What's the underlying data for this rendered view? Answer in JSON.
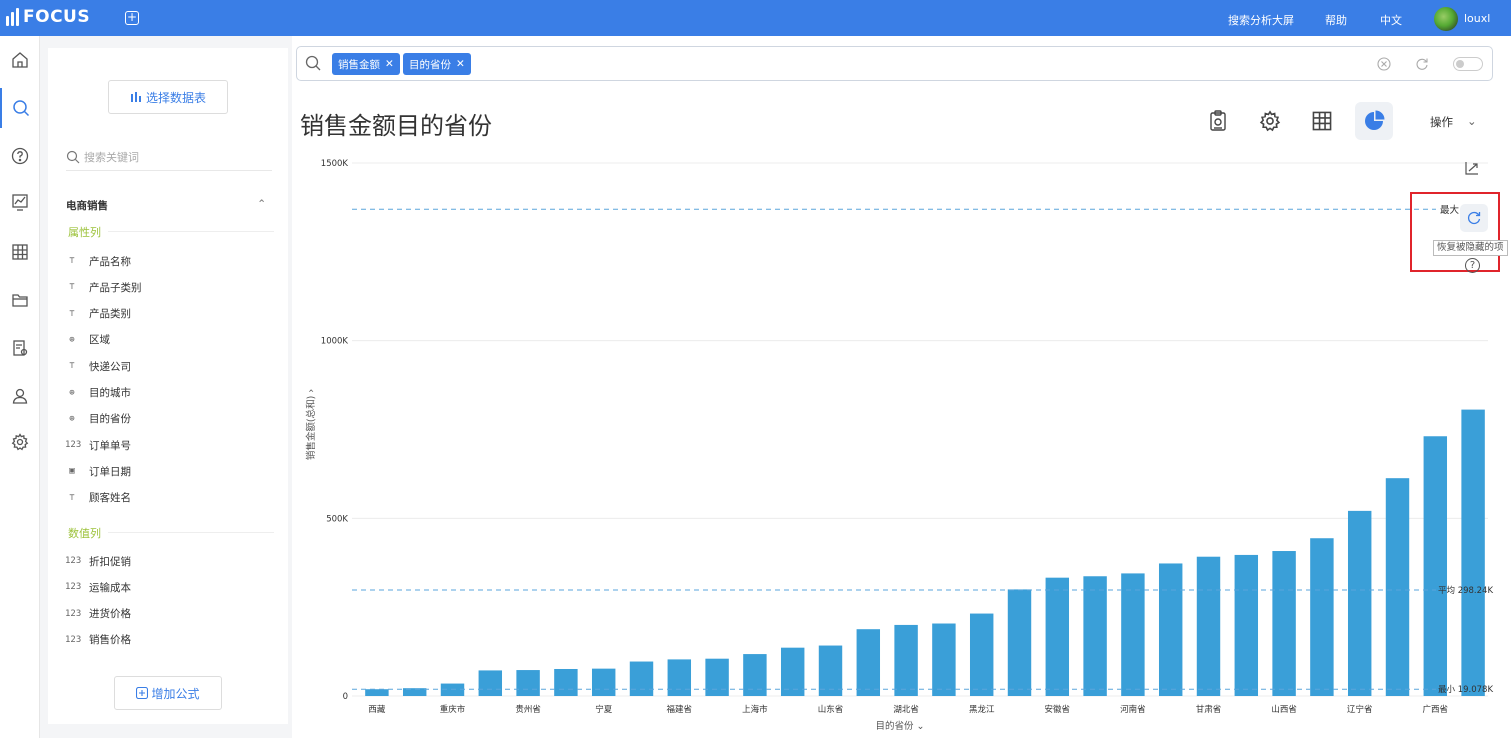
{
  "app": {
    "logo_text": "FOCUS",
    "nav_links": [
      "搜索分析大屏",
      "帮助",
      "中文"
    ],
    "username": "louxl"
  },
  "rail": {
    "items": [
      "home-icon",
      "search-icon",
      "help-icon",
      "dashboard-icon",
      "table-icon",
      "folder-icon",
      "report-settings-icon",
      "user-icon",
      "settings-icon"
    ],
    "active": "search-icon"
  },
  "panel": {
    "select_table_label": "选择数据表",
    "search_placeholder": "搜索关键词",
    "group_name": "电商销售",
    "attribute_section": "属性列",
    "attribute_columns": [
      {
        "icon": "text-type-icon",
        "label": "产品名称"
      },
      {
        "icon": "text-type-icon",
        "label": "产品子类别"
      },
      {
        "icon": "text-type-icon",
        "label": "产品类别"
      },
      {
        "icon": "globe-icon",
        "label": "区域"
      },
      {
        "icon": "text-type-icon",
        "label": "快递公司"
      },
      {
        "icon": "globe-icon",
        "label": "目的城市"
      },
      {
        "icon": "globe-icon",
        "label": "目的省份"
      },
      {
        "icon": "number-type-icon",
        "label": "订单单号"
      },
      {
        "icon": "calendar-icon",
        "label": "订单日期"
      },
      {
        "icon": "text-type-icon",
        "label": "顾客姓名"
      }
    ],
    "number_section": "数值列",
    "number_columns": [
      {
        "icon": "number-type-icon",
        "label": "折扣促销"
      },
      {
        "icon": "number-type-icon",
        "label": "运输成本"
      },
      {
        "icon": "number-type-icon",
        "label": "进货价格"
      },
      {
        "icon": "number-type-icon",
        "label": "销售价格"
      }
    ],
    "add_formula_label": "增加公式"
  },
  "search": {
    "tokens": [
      "销售金额",
      "目的省份"
    ]
  },
  "main": {
    "title": "销售金额目的省份",
    "ops_label": "操作"
  },
  "tooltip": {
    "max_label": "最大",
    "restore_text": "恢复被隐藏的项",
    "help_glyph": "?"
  },
  "colors": {
    "brand": "#3a7ee6",
    "bar": "#3a9fd8",
    "highlight": "#e0242b"
  },
  "chart_data": {
    "type": "bar",
    "xlabel": "目的省份",
    "ylabel": "销售金额(总和)",
    "ylim": [
      0,
      1500000
    ],
    "y_ticks": [
      {
        "value": 0,
        "label": "0"
      },
      {
        "value": 500000,
        "label": "500K"
      },
      {
        "value": 1000000,
        "label": "1000K"
      },
      {
        "value": 1500000,
        "label": "1500K"
      }
    ],
    "categories": [
      "西藏",
      "",
      "重庆市",
      "",
      "贵州省",
      "",
      "宁夏",
      "",
      "福建省",
      "",
      "上海市",
      "",
      "山东省",
      "",
      "湖北省",
      "",
      "黑龙江",
      "",
      "安徽省",
      "",
      "河南省",
      "",
      "甘肃省",
      "",
      "山西省",
      "",
      "辽宁省",
      "",
      "广西省"
    ],
    "values": [
      19078,
      22000,
      35000,
      72000,
      73000,
      76000,
      77000,
      97000,
      103000,
      105000,
      118000,
      136000,
      142000,
      188000,
      200000,
      204000,
      232000,
      300000,
      333000,
      337000,
      345000,
      373000,
      392000,
      397000,
      408000,
      444000,
      521000,
      613000,
      731000,
      806000
    ],
    "reference_lines": [
      {
        "label": "最大",
        "value": 1370000
      },
      {
        "label": "平均 298.24K",
        "value": 298240
      },
      {
        "label": "最小 19.078K",
        "value": 19078
      }
    ],
    "grid": true,
    "legend": "none"
  }
}
